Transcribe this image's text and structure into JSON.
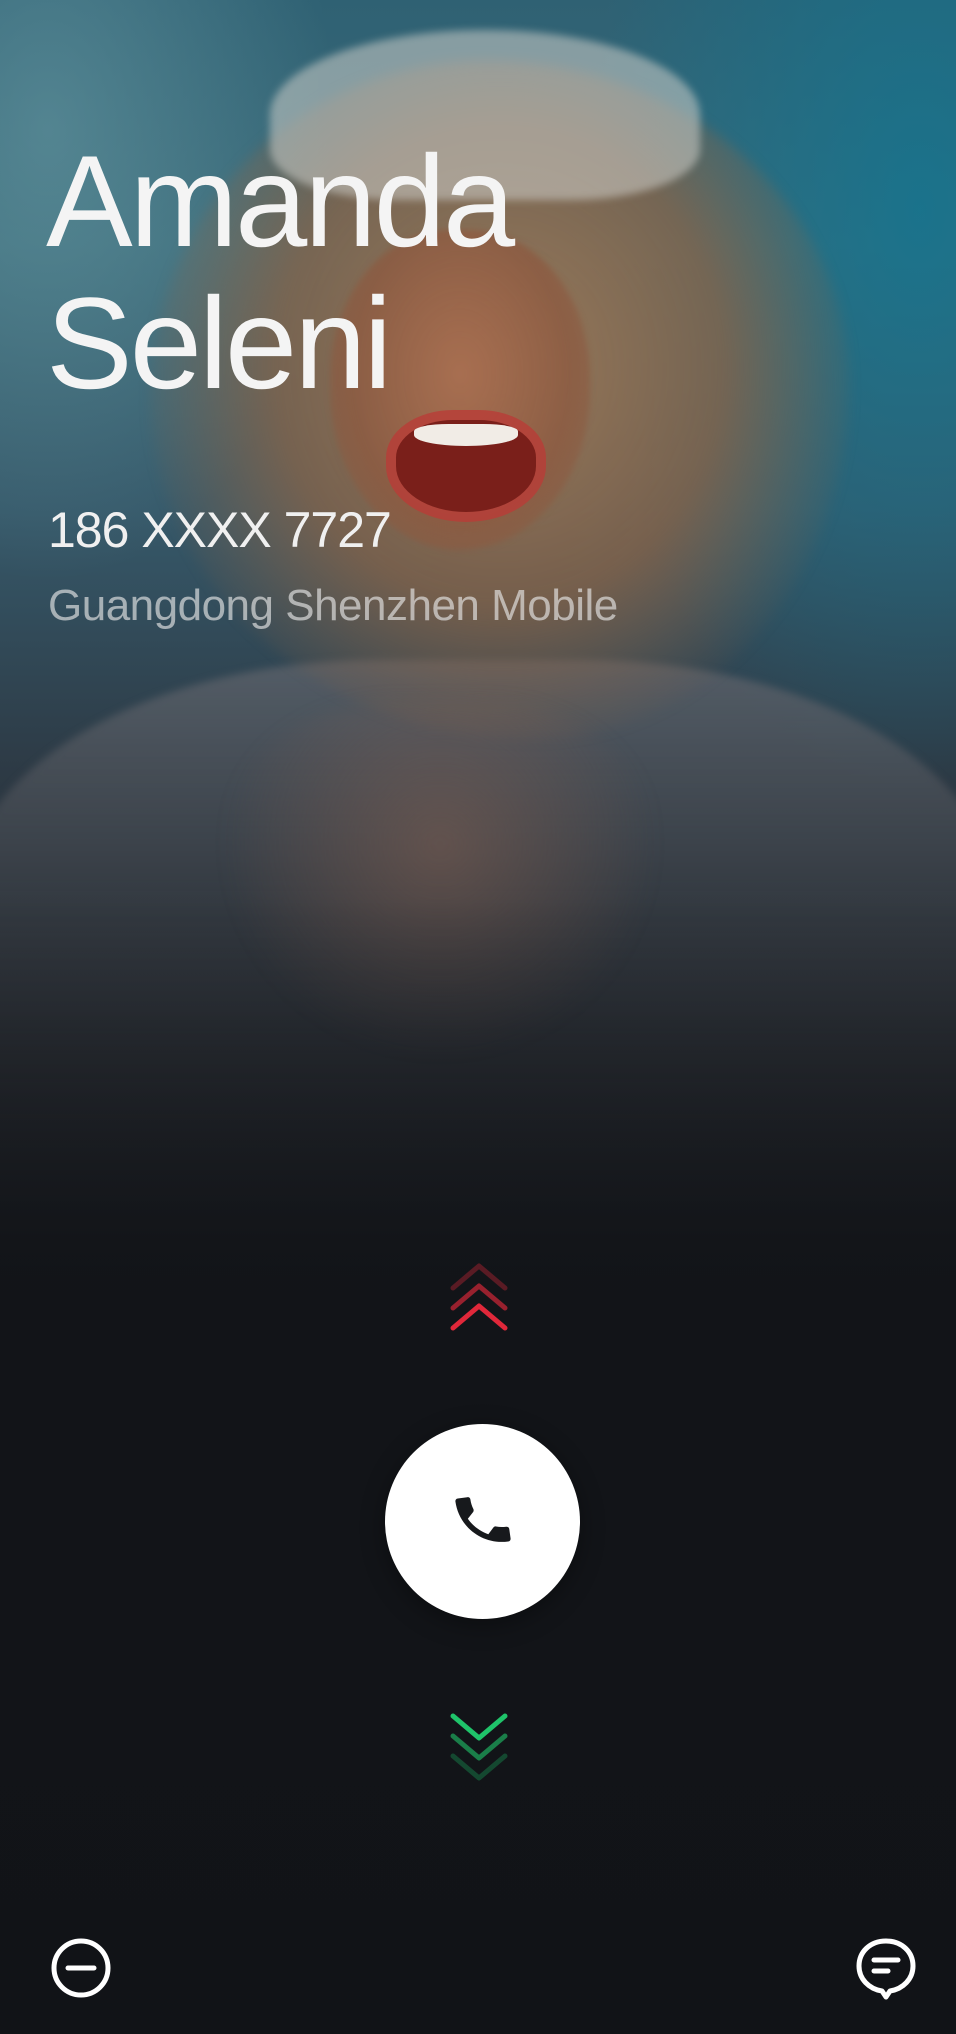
{
  "caller": {
    "name": "Amanda\nSeleni",
    "number": "186 XXXX 7727",
    "location": "Guangdong Shenzhen Mobile"
  },
  "controls": {
    "swipe_up_icon": "chevrons-up-icon",
    "answer_icon": "phone-icon",
    "swipe_down_icon": "chevrons-down-icon",
    "left_icon": "minus-circle-icon",
    "right_icon": "message-bubble-icon"
  },
  "colors": {
    "decline_red": "#e0283a",
    "accept_green": "#1fc46a",
    "background_dark": "#111317",
    "teal_accent": "#10768f"
  }
}
